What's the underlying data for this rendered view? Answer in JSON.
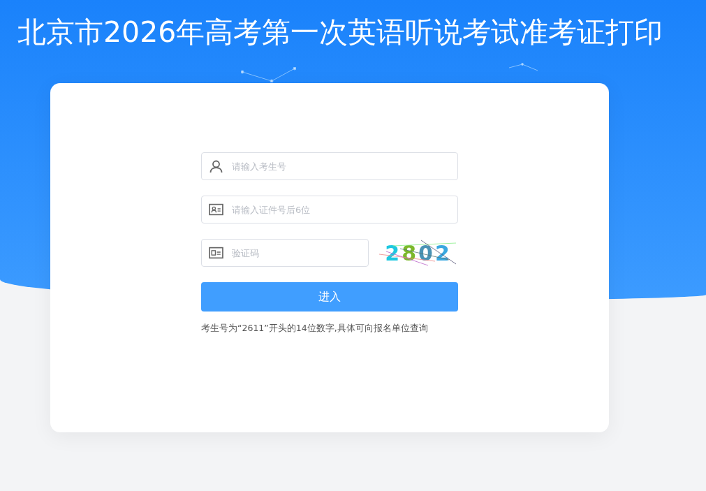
{
  "title": "北京市2026年高考第一次英语听说考试准考证打印",
  "fields": [
    {
      "kind": "user",
      "placeholder": "请输入考生号"
    },
    {
      "kind": "idcard",
      "placeholder": "请输入证件号后6位"
    },
    {
      "kind": "captcha",
      "placeholder": "验证码"
    }
  ],
  "captcha": "2802",
  "submit": "进入",
  "hint": "考生号为“2611”开头的14位数字,具体可向报名单位查询"
}
